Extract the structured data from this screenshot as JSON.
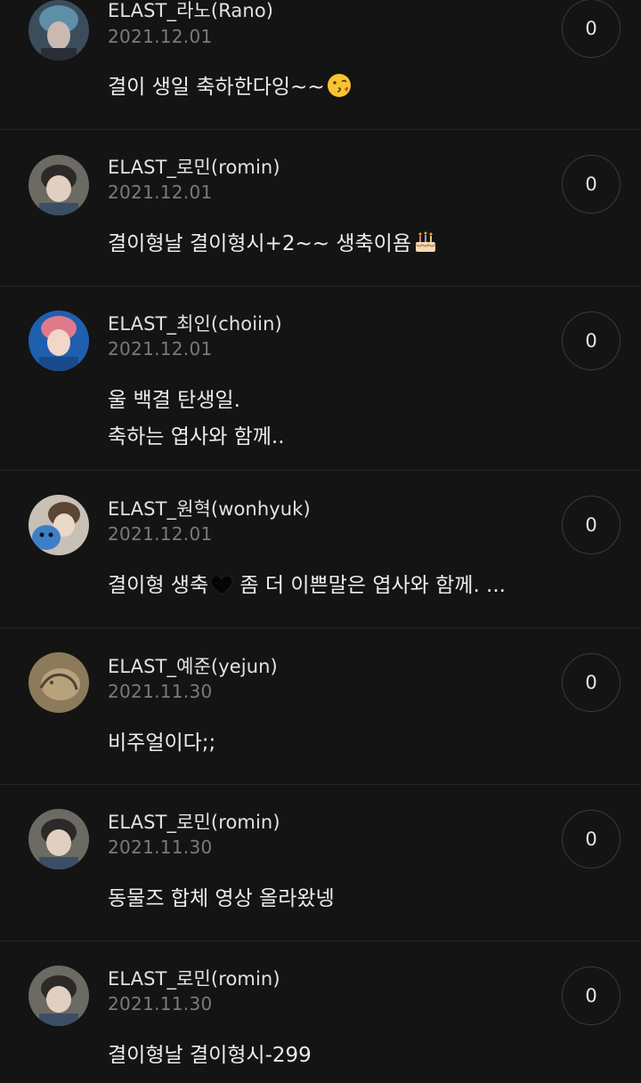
{
  "comments": [
    {
      "username": "ELAST_라노(Rano)",
      "date": "2021.12.01",
      "lines": [
        "결이 생일 축하한다잉~~"
      ],
      "emoji": "kiss-face-icon",
      "likes": "0",
      "avatar_colors": [
        "#5d8fa8",
        "#c9b9b0",
        "#3b4c5c"
      ]
    },
    {
      "username": "ELAST_로민(romin)",
      "date": "2021.12.01",
      "lines": [
        "결이형날 결이형시+2~~ 생축이욤"
      ],
      "emoji": "birthday-cake-icon",
      "likes": "0",
      "avatar_colors": [
        "#6b6a63",
        "#e1cfc2",
        "#2c2a28"
      ]
    },
    {
      "username": "ELAST_최인(choiin)",
      "date": "2021.12.01",
      "lines": [
        "울 백결 탄생일.",
        "축하는 엽사와 함께.."
      ],
      "emoji": "",
      "likes": "0",
      "avatar_colors": [
        "#1f5fb0",
        "#e07a8a",
        "#f0d7c8"
      ]
    },
    {
      "username": "ELAST_원혁(wonhyuk)",
      "date": "2021.12.01",
      "lines": [
        "결이형 생축 좀 더 이쁜말은 엽사와 함께. ..."
      ],
      "emoji": "black-heart-icon",
      "likes": "0",
      "avatar_colors": [
        "#c9c0b5",
        "#3d7fc7",
        "#5a4634"
      ]
    },
    {
      "username": "ELAST_예준(yejun)",
      "date": "2021.11.30",
      "lines": [
        "비주얼이다;;"
      ],
      "emoji": "",
      "likes": "0",
      "avatar_colors": [
        "#8d7a5a",
        "#b7a27c",
        "#4e4333"
      ]
    },
    {
      "username": "ELAST_로민(romin)",
      "date": "2021.11.30",
      "lines": [
        "동물즈 합체 영상 올라왔넹"
      ],
      "emoji": "",
      "likes": "0",
      "avatar_colors": [
        "#6b6a63",
        "#e1cfc2",
        "#2c2a28"
      ]
    },
    {
      "username": "ELAST_로민(romin)",
      "date": "2021.11.30",
      "lines": [
        "결이형날 결이형시-299"
      ],
      "emoji": "",
      "likes": "0",
      "avatar_colors": [
        "#6b6a63",
        "#e1cfc2",
        "#2c2a28"
      ]
    }
  ]
}
